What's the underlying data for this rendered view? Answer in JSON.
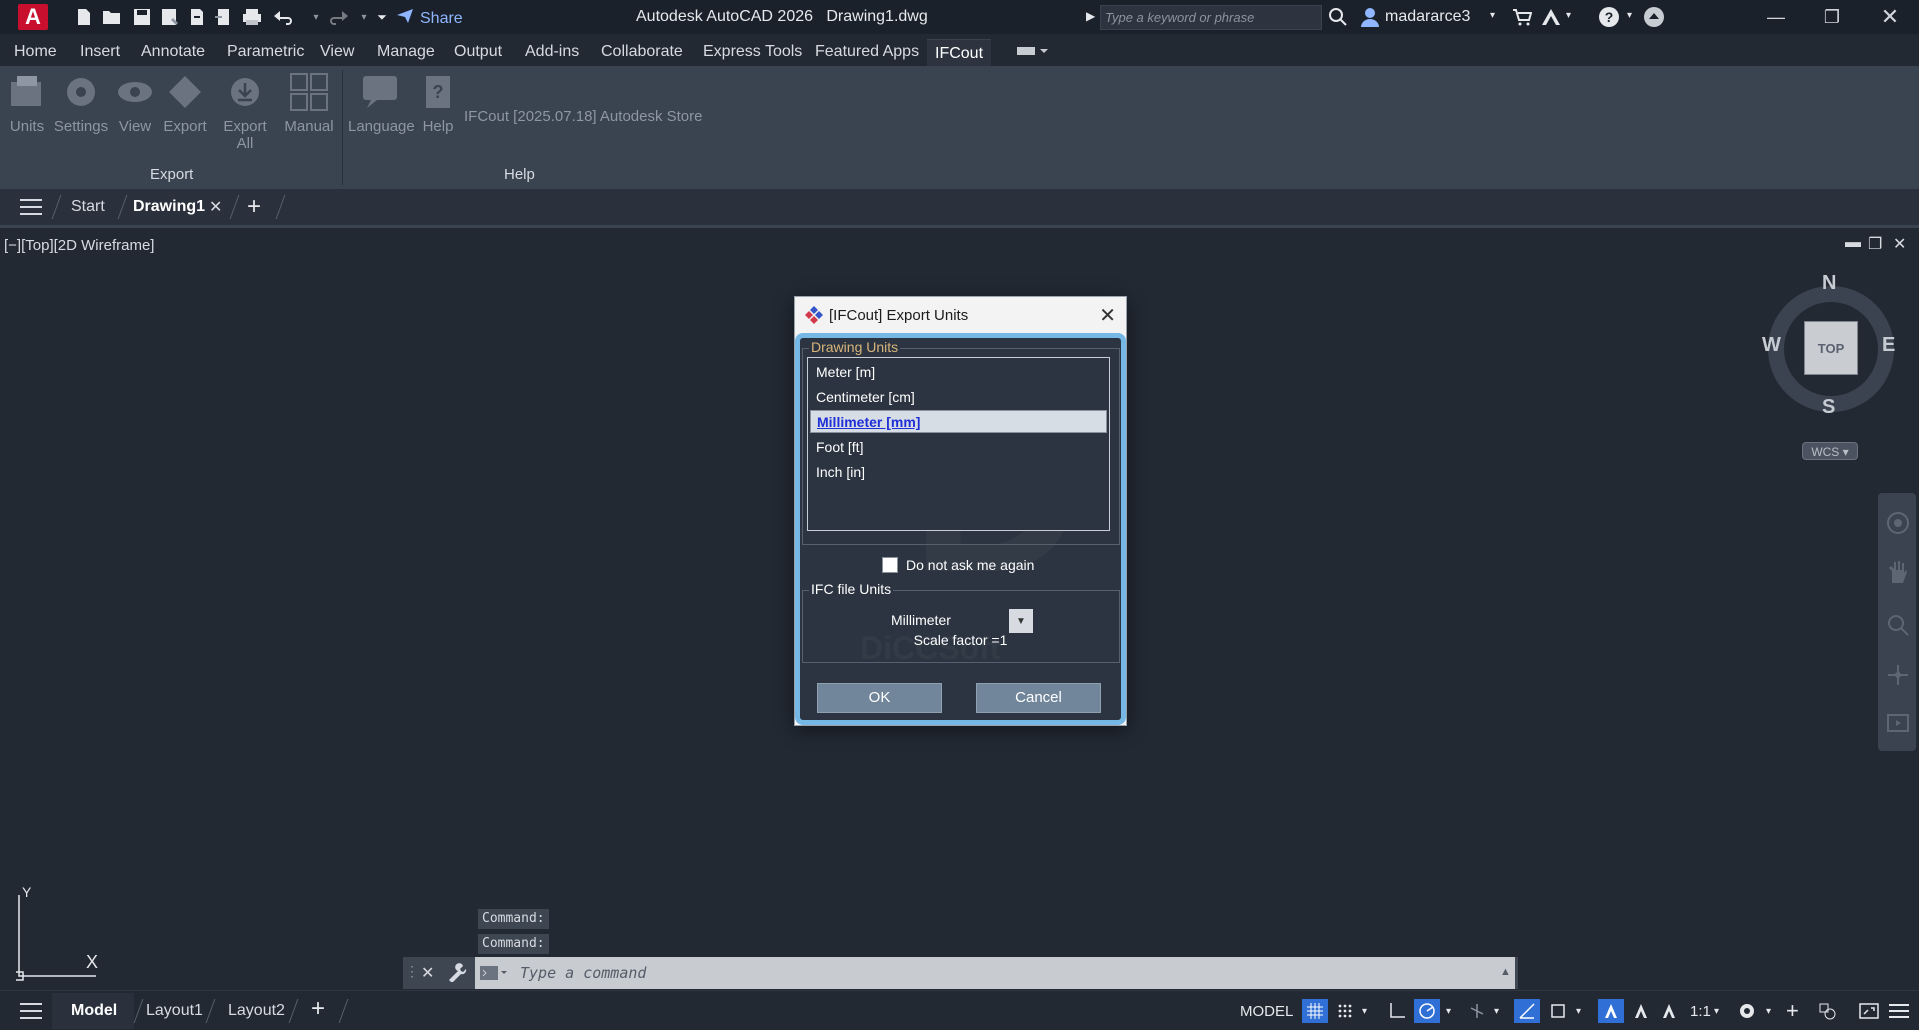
{
  "titlebar": {
    "app_logo": "A",
    "share_label": "Share",
    "app_title": "Autodesk AutoCAD 2026",
    "file_title": "Drawing1.dwg",
    "search_placeholder": "Type a keyword or phrase",
    "username": "madararce3"
  },
  "menu": {
    "items": [
      "Home",
      "Insert",
      "Annotate",
      "Parametric",
      "View",
      "Manage",
      "Output",
      "Add-ins",
      "Collaborate",
      "Express Tools",
      "Featured Apps",
      "IFCout"
    ],
    "active": "IFCout"
  },
  "ribbon": {
    "export_buttons": [
      "Units",
      "Settings",
      "View",
      "Export",
      "Export All",
      "Manual"
    ],
    "help_buttons": [
      "Language",
      "Help"
    ],
    "store_text": "IFCout [2025.07.18] Autodesk Store",
    "panels": {
      "export": "Export",
      "help": "Help"
    }
  },
  "file_tabs": {
    "start": "Start",
    "drawing": "Drawing1"
  },
  "viewport": {
    "label": "[−][Top][2D Wireframe]",
    "viewcube": {
      "top": "TOP",
      "n": "N",
      "s": "S",
      "e": "E",
      "w": "W",
      "wcs": "WCS"
    },
    "ucs": {
      "x": "X",
      "y": "Y"
    }
  },
  "dialog": {
    "title": "[IFCout] Export Units",
    "drawing_units_label": "Drawing Units",
    "units": [
      "Meter [m]",
      "Centimeter [cm]",
      "Millimeter [mm]",
      "Foot [ft]",
      "Inch [in]"
    ],
    "selected_unit": "Millimeter [mm]",
    "do_not_ask_label": "Do not ask me again",
    "do_not_ask_checked": false,
    "ifc_units_label": "IFC file Units",
    "ifc_unit_value": "Millimeter",
    "scale_factor": "Scale factor =1",
    "ok_label": "OK",
    "cancel_label": "Cancel",
    "watermark": "DiCCSoft"
  },
  "command": {
    "history": [
      "Command:",
      "Command:"
    ],
    "placeholder": "Type a command"
  },
  "statusbar": {
    "layouts": [
      "Model",
      "Layout1",
      "Layout2"
    ],
    "model_label": "MODEL",
    "scale": "1:1"
  },
  "colors": {
    "accent": "#2f6fd6",
    "dialog_border": "#75b8e6",
    "selected_text": "#1f2fd6",
    "autocad_red": "#c8102e"
  }
}
